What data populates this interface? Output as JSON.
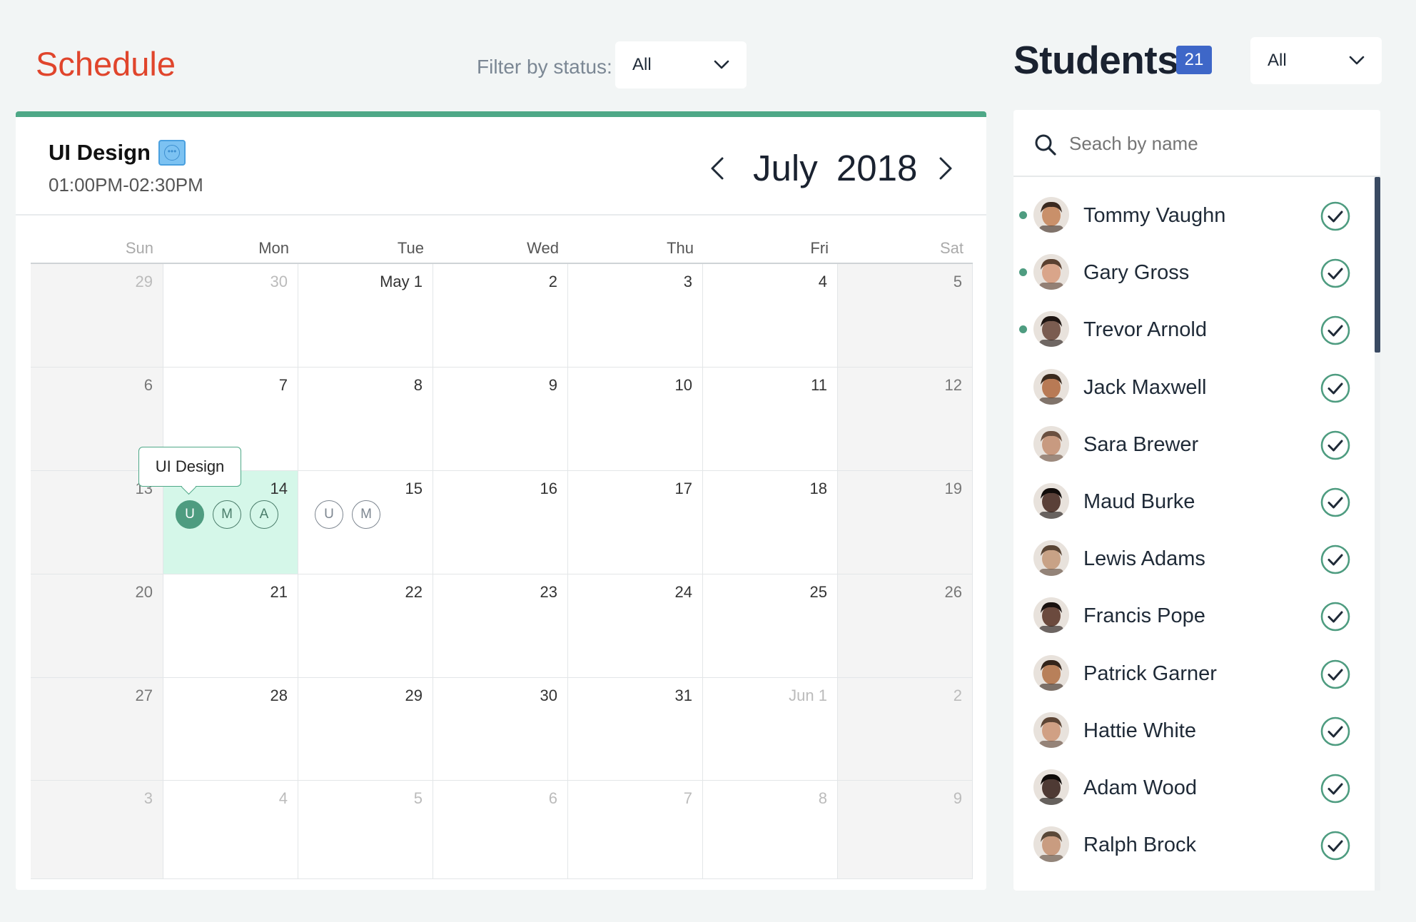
{
  "schedule": {
    "title": "Schedule",
    "filter_label": "Filter by status:",
    "filter_value": "All"
  },
  "course": {
    "title": "UI Design",
    "time": "01:00PM-02:30PM",
    "month": "July",
    "year": "2018"
  },
  "calendar": {
    "weekdays": [
      "Sun",
      "Mon",
      "Tue",
      "Wed",
      "Thu",
      "Fri",
      "Sat"
    ],
    "weeks": [
      [
        "29",
        "30",
        "May 1",
        "2",
        "3",
        "4",
        "5"
      ],
      [
        "6",
        "7",
        "8",
        "9",
        "10",
        "11",
        "12"
      ],
      [
        "13",
        "14",
        "15",
        "16",
        "17",
        "18",
        "19"
      ],
      [
        "20",
        "21",
        "22",
        "23",
        "24",
        "25",
        "26"
      ],
      [
        "27",
        "28",
        "29",
        "30",
        "31",
        "Jun 1",
        "2"
      ],
      [
        "3",
        "4",
        "5",
        "6",
        "7",
        "8",
        "9"
      ]
    ],
    "tooltip": "UI Design",
    "events_14": [
      "U",
      "M",
      "A"
    ],
    "events_15": [
      "U",
      "M"
    ]
  },
  "students": {
    "title": "Students",
    "count": "21",
    "filter_value": "All",
    "search_placeholder": "Seach by name",
    "list": [
      {
        "name": "Tommy Vaughn",
        "online": true
      },
      {
        "name": "Gary Gross",
        "online": true
      },
      {
        "name": "Trevor Arnold",
        "online": true
      },
      {
        "name": "Jack Maxwell",
        "online": false
      },
      {
        "name": "Sara Brewer",
        "online": false
      },
      {
        "name": "Maud Burke",
        "online": false
      },
      {
        "name": "Lewis Adams",
        "online": false
      },
      {
        "name": "Francis Pope",
        "online": false
      },
      {
        "name": "Patrick Garner",
        "online": false
      },
      {
        "name": "Hattie White",
        "online": false
      },
      {
        "name": "Adam Wood",
        "online": false
      },
      {
        "name": "Ralph Brock",
        "online": false
      }
    ]
  },
  "colors": {
    "accent": "#e0452c",
    "green": "#4ea887",
    "badge": "#3e67c8",
    "highlight": "#d5f7e9"
  }
}
